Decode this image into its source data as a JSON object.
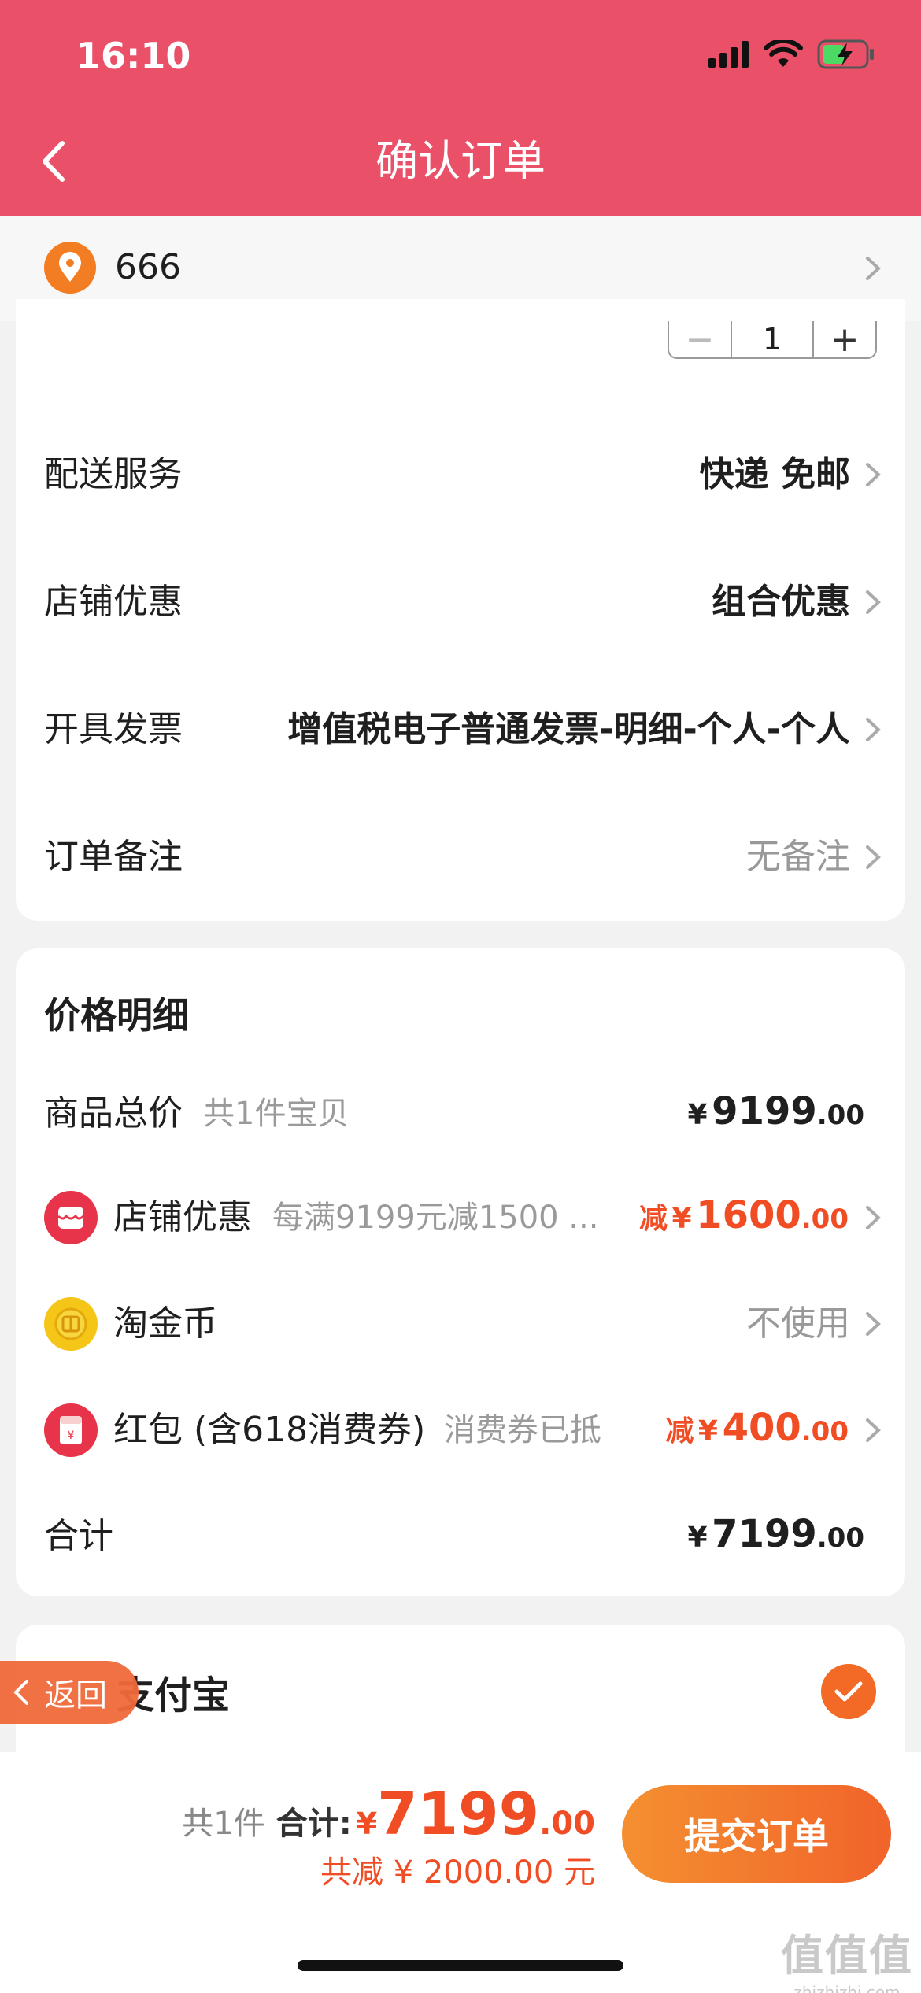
{
  "status": {
    "time": "16:10"
  },
  "nav": {
    "title": "确认订单"
  },
  "address": {
    "name": "666"
  },
  "stepper": {
    "minus": "−",
    "value": "1",
    "plus": "+"
  },
  "delivery": {
    "label": "配送服务",
    "value": "快递 免邮"
  },
  "shop_discount": {
    "label": "店铺优惠",
    "value": "组合优惠"
  },
  "invoice": {
    "label": "开具发票",
    "value": "增值税电子普通发票-明细-个人-个人"
  },
  "remark": {
    "label": "订单备注",
    "value": "无备注"
  },
  "price_detail": {
    "title": "价格明细",
    "total": {
      "label": "商品总价",
      "sub": "共1件宝贝",
      "currency": "¥",
      "int": "9199",
      "dec": ".00"
    },
    "shop": {
      "label": "店铺优惠",
      "sub": "每满9199元减1500 ...",
      "prefix": "减",
      "currency": "¥",
      "int": "1600",
      "dec": ".00"
    },
    "coin": {
      "label": "淘金币",
      "value": "不使用"
    },
    "redpacket": {
      "label": "红包 (含618消费券)",
      "sub": "消费券已抵",
      "prefix": "减",
      "currency": "¥",
      "int": "400",
      "dec": ".00"
    },
    "sum": {
      "label": "合计",
      "currency": "¥",
      "int": "7199",
      "dec": ".00"
    }
  },
  "payment": {
    "label": "支付宝"
  },
  "float_back": {
    "label": "返回"
  },
  "bottom": {
    "count": "共1件",
    "total_label": "合计:",
    "currency": "¥",
    "int": "7199",
    "dec": ".00",
    "saved": "共减 ¥ 2000.00 元",
    "submit": "提交订单"
  },
  "watermark": {
    "logo": "值值值",
    "sub": "zhizhizhi.com"
  },
  "colors": {
    "header": "#ea5068",
    "accent": "#f04d24",
    "button": "#f1632a"
  },
  "icons": [
    "back-arrow-icon",
    "location-pin-icon",
    "chevron-right-icon",
    "shop-icon",
    "gold-coin-icon",
    "red-packet-icon",
    "check-icon",
    "signal-icon",
    "wifi-icon",
    "battery-icon"
  ]
}
